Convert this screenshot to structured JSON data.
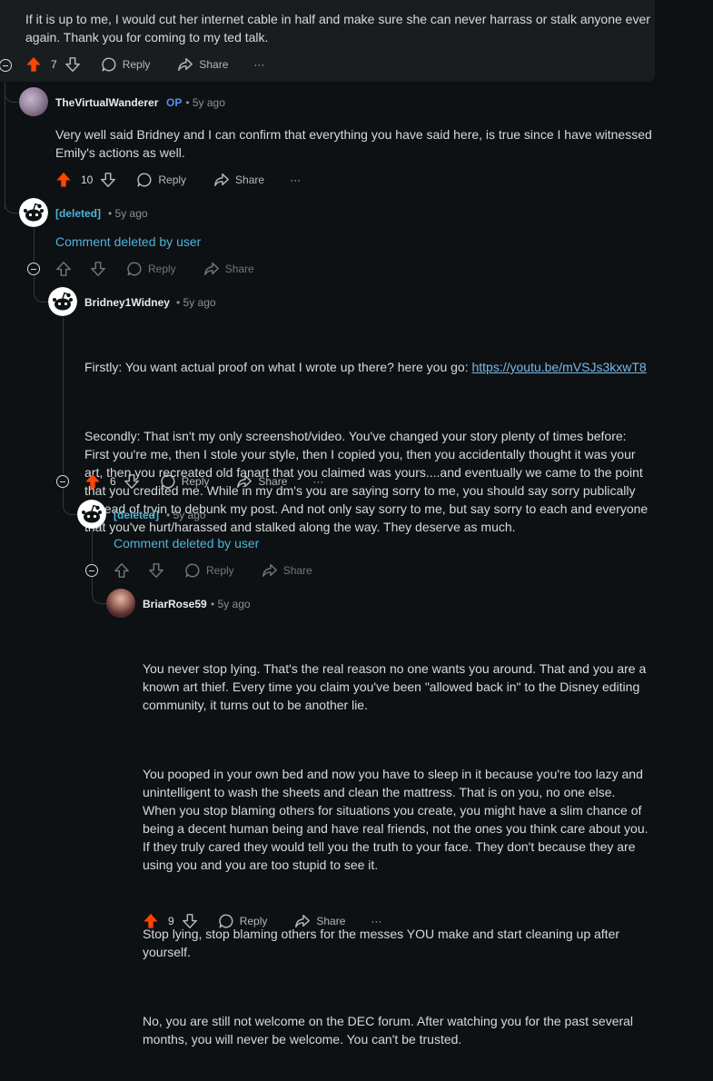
{
  "actions": {
    "reply": "Reply",
    "share": "Share",
    "more": "···"
  },
  "comments": {
    "top": {
      "text": "If it is up to me, I would cut her internet cable in half and make sure she can never harrass or stalk anyone ever again. Thank you for coming to my ted talk.",
      "votes": "7"
    },
    "virtual": {
      "author": "TheVirtualWanderer",
      "op_badge": "OP",
      "time": "• 5y ago",
      "text": "Very well said Bridney and I can confirm that everything you have said here, is true since I have witnessed Emily's actions as well.",
      "votes": "10"
    },
    "deleted1": {
      "author": "[deleted]",
      "time": "• 5y ago",
      "text": "Comment deleted by user"
    },
    "bridney": {
      "author": "Bridney1Widney",
      "time": "• 5y ago",
      "p1_text": "Firstly: You want actual proof on what I wrote up there? here you go: ",
      "p1_link": "https://youtu.be/mVSJs3kxwT8",
      "p2": "Secondly: That isn't my only screenshot/video. You've changed your story plenty of times before: First you're me, then I stole your style, then I copied you, then you accidentally thought it was your art, then you recreated old fanart that you claimed was yours....and eventually we came to the point that you credited me. While in my dm's you are saying sorry to me, you should say sorry publically instead of tryin to debunk my post. And not only say sorry to me, but say sorry to each and everyone that you've hurt/harassed and stalked along the way. They deserve as much.",
      "votes": "6"
    },
    "deleted2": {
      "author": "[deleted]",
      "time": "• 5y ago",
      "text": "Comment deleted by user"
    },
    "briar": {
      "author": "BriarRose59",
      "time": "• 5y ago",
      "paragraphs": [
        "You never stop lying. That's the real reason no one wants you around. That and you are a known art thief. Every time you claim you've been \"allowed back in\" to the Disney editing community, it turns out to be another lie.",
        "You pooped in your own bed and now you have to sleep in it because you're too lazy and unintelligent to wash the sheets and clean the mattress. That is on you, no one else. When you stop blaming others for situations you create, you might have a slim chance of being a decent human being and have real friends, not the ones you think care about you. If they truly cared they would tell you the truth to your face. They don't because they are using you and you are too stupid to see it.",
        "Stop lying, stop blaming others for the messes YOU make and start cleaning up after yourself.",
        "No, you are still not welcome on the DEC forum. After watching you for the past several months, you will never be welcome. You can't be trusted."
      ],
      "votes": "9"
    }
  },
  "colors": {
    "upvote": "#ff4500",
    "deleted": "#4fb3d9",
    "op": "#5c8cf2",
    "background": "#0e1113"
  },
  "icons": [
    "upvote-icon",
    "downvote-icon",
    "comment-icon",
    "share-icon",
    "more-icon",
    "collapse-icon"
  ]
}
